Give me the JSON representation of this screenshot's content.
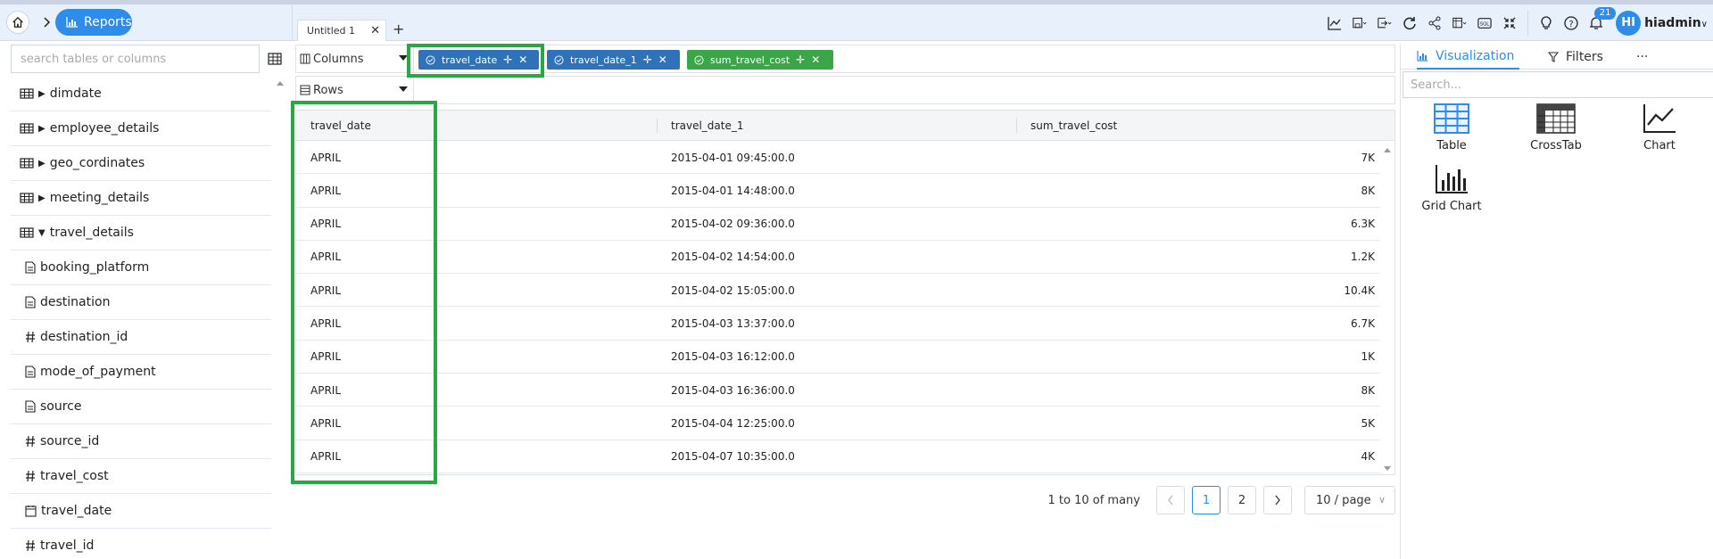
{
  "nav": {
    "reports_label": "Reports"
  },
  "tabs": [
    {
      "label": "Untitled 1"
    }
  ],
  "toolbar": {
    "notification_count": "21",
    "avatar_initials": "HI",
    "username": "hiadmin"
  },
  "sidebar": {
    "search_placeholder": "search tables or columns",
    "tables": [
      {
        "label": "dimdate"
      },
      {
        "label": "employee_details"
      },
      {
        "label": "geo_cordinates"
      },
      {
        "label": "meeting_details"
      },
      {
        "label": "travel_details"
      }
    ],
    "columns": [
      {
        "label": "booking_platform"
      },
      {
        "label": "destination"
      },
      {
        "label": "destination_id"
      },
      {
        "label": "mode_of_payment"
      },
      {
        "label": "source"
      },
      {
        "label": "source_id"
      },
      {
        "label": "travel_cost"
      },
      {
        "label": "travel_date"
      },
      {
        "label": "travel_id"
      }
    ]
  },
  "shelves": {
    "columns_label": "Columns",
    "rows_label": "Rows",
    "pills": [
      {
        "label": "travel_date",
        "color": "#2f72b8"
      },
      {
        "label": "travel_date_1",
        "color": "#2f72b8"
      },
      {
        "label": "sum_travel_cost",
        "color": "#3aa648"
      }
    ]
  },
  "grid": {
    "headers": [
      "travel_date",
      "travel_date_1",
      "sum_travel_cost"
    ],
    "rows": [
      [
        "APRIL",
        "2015-04-01 09:45:00.0",
        "7K"
      ],
      [
        "APRIL",
        "2015-04-01 14:48:00.0",
        "8K"
      ],
      [
        "APRIL",
        "2015-04-02 09:36:00.0",
        "6.3K"
      ],
      [
        "APRIL",
        "2015-04-02 14:54:00.0",
        "1.2K"
      ],
      [
        "APRIL",
        "2015-04-02 15:05:00.0",
        "10.4K"
      ],
      [
        "APRIL",
        "2015-04-03 13:37:00.0",
        "6.7K"
      ],
      [
        "APRIL",
        "2015-04-03 16:12:00.0",
        "1K"
      ],
      [
        "APRIL",
        "2015-04-03 16:36:00.0",
        "8K"
      ],
      [
        "APRIL",
        "2015-04-04 12:25:00.0",
        "5K"
      ],
      [
        "APRIL",
        "2015-04-07 10:35:00.0",
        "4K"
      ]
    ]
  },
  "pagination": {
    "range_text": "1 to 10 of many",
    "pages": [
      "1",
      "2"
    ],
    "page_size": "10 / page"
  },
  "right_panel": {
    "tabs": [
      {
        "label": "Visualization"
      },
      {
        "label": "Filters"
      },
      {
        "label": "···"
      }
    ],
    "search_placeholder": "Search...",
    "items": [
      {
        "label": "Table"
      },
      {
        "label": "CrossTab"
      },
      {
        "label": "Chart"
      },
      {
        "label": "Grid Chart"
      }
    ]
  },
  "colors": {
    "accent": "#2e8ceb",
    "highlight": "#27a844",
    "pill_blue": "#2f72b8",
    "pill_green": "#3aa648"
  }
}
